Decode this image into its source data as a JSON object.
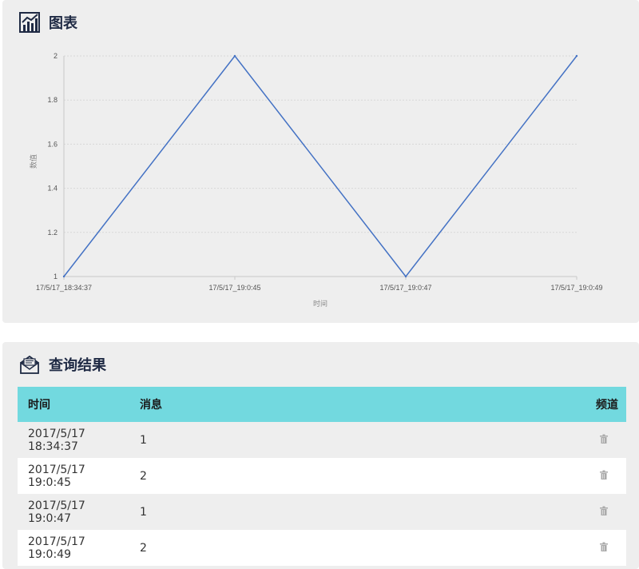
{
  "chart_panel": {
    "title": "图表",
    "icon": "line-chart-icon"
  },
  "chart_data": {
    "type": "line",
    "x": [
      "17/5/17_18:34:37",
      "17/5/17_19:0:45",
      "17/5/17_19:0:47",
      "17/5/17_19:0:49"
    ],
    "series": [
      {
        "values": [
          1,
          2,
          1,
          2
        ],
        "color": "#4472c4"
      }
    ],
    "xlabel": "时间",
    "ylabel": "数值",
    "ylim": [
      1,
      2
    ],
    "yticks": [
      "1",
      "1.2",
      "1.4",
      "1.6",
      "1.8",
      "2"
    ],
    "grid": true
  },
  "results_panel": {
    "title": "查询结果",
    "icon": "envelope-icon",
    "columns": {
      "time": "时间",
      "message": "消息",
      "channel": "频道"
    },
    "rows": [
      {
        "time": "2017/5/17 18:34:37",
        "message": "1",
        "action_icon": "trash-icon"
      },
      {
        "time": "2017/5/17 19:0:45",
        "message": "2",
        "action_icon": "trash-icon"
      },
      {
        "time": "2017/5/17 19:0:47",
        "message": "1",
        "action_icon": "trash-icon"
      },
      {
        "time": "2017/5/17 19:0:49",
        "message": "2",
        "action_icon": "trash-icon"
      }
    ]
  },
  "colors": {
    "header_accent": "#72d9df",
    "line": "#4472c4",
    "panel_bg": "#eeeeee"
  }
}
